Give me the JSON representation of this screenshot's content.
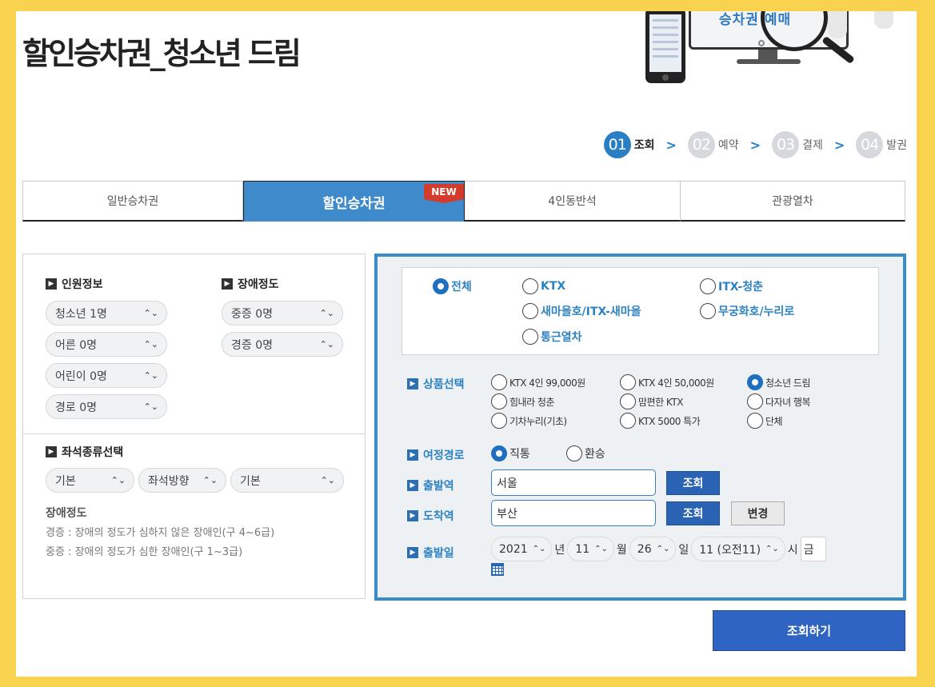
{
  "page_title": "할인승차권_청소년 드림",
  "hero": {
    "caption": "승차권 예매"
  },
  "steps": [
    {
      "num": "01",
      "label": "조회",
      "active": true
    },
    {
      "num": "02",
      "label": "예약",
      "active": false
    },
    {
      "num": "03",
      "label": "결제",
      "active": false
    },
    {
      "num": "04",
      "label": "발권",
      "active": false
    }
  ],
  "step_separator": ">",
  "tabs": [
    {
      "label": "일반승차권",
      "active": false
    },
    {
      "label": "할인승차권",
      "active": true,
      "badge": "NEW"
    },
    {
      "label": "4인동반석",
      "active": false
    },
    {
      "label": "관광열차",
      "active": false
    }
  ],
  "passenger": {
    "title": "인원정보",
    "selects": [
      "청소년 1명",
      "어른 0명",
      "어린이 0명",
      "경로 0명"
    ]
  },
  "disability": {
    "title": "장애정도",
    "selects": [
      "중증 0명",
      "경증 0명"
    ]
  },
  "seat": {
    "title": "좌석종류선택",
    "selects": [
      "기본",
      "좌석방향",
      "기본"
    ]
  },
  "note": {
    "title": "장애정도",
    "lines": [
      "경증 : 장애의 정도가 심하지 않은 장애인(구 4~6급)",
      "중증 : 장애의 정도가 심한 장애인(구 1~3급)"
    ]
  },
  "train_types": [
    {
      "label": "전체",
      "selected": true
    },
    {
      "label": "KTX",
      "selected": false
    },
    {
      "label": "ITX-청춘",
      "selected": false
    },
    {
      "label": "새마을호/ITX-새마을",
      "selected": false
    },
    {
      "label": "무궁화호/누리로",
      "selected": false
    },
    {
      "label": "통근열차",
      "selected": false
    }
  ],
  "product": {
    "label": "상품선택",
    "options": [
      {
        "label": "KTX 4인 99,000원",
        "selected": false
      },
      {
        "label": "KTX 4인 50,000원",
        "selected": false
      },
      {
        "label": "청소년 드림",
        "selected": true
      },
      {
        "label": "힘내라 청춘",
        "selected": false
      },
      {
        "label": "맘편한 KTX",
        "selected": false
      },
      {
        "label": "다자녀 행복",
        "selected": false
      },
      {
        "label": "기차누리(기초)",
        "selected": false
      },
      {
        "label": "KTX 5000 특가",
        "selected": false
      },
      {
        "label": "단체",
        "selected": false
      }
    ]
  },
  "route": {
    "label": "여정경로",
    "options": [
      {
        "label": "직통",
        "selected": true
      },
      {
        "label": "환승",
        "selected": false
      }
    ]
  },
  "departure": {
    "label": "출발역",
    "value": "서울",
    "button": "조회"
  },
  "arrival": {
    "label": "도착역",
    "value": "부산",
    "button": "조회",
    "swap_button": "변경"
  },
  "date": {
    "label": "출발일",
    "year": "2021",
    "year_unit": "년",
    "month": "11",
    "month_unit": "월",
    "day": "26",
    "day_unit": "일",
    "hour": "11 (오전11)",
    "hour_unit": "시",
    "weekday": "금"
  },
  "submit_label": "조회하기",
  "colors": {
    "accent": "#2a7ec4",
    "tab_active": "#3e8acb",
    "panel_border": "#3a8cc8",
    "button": "#2a63b4",
    "frame": "#f9d34f"
  }
}
